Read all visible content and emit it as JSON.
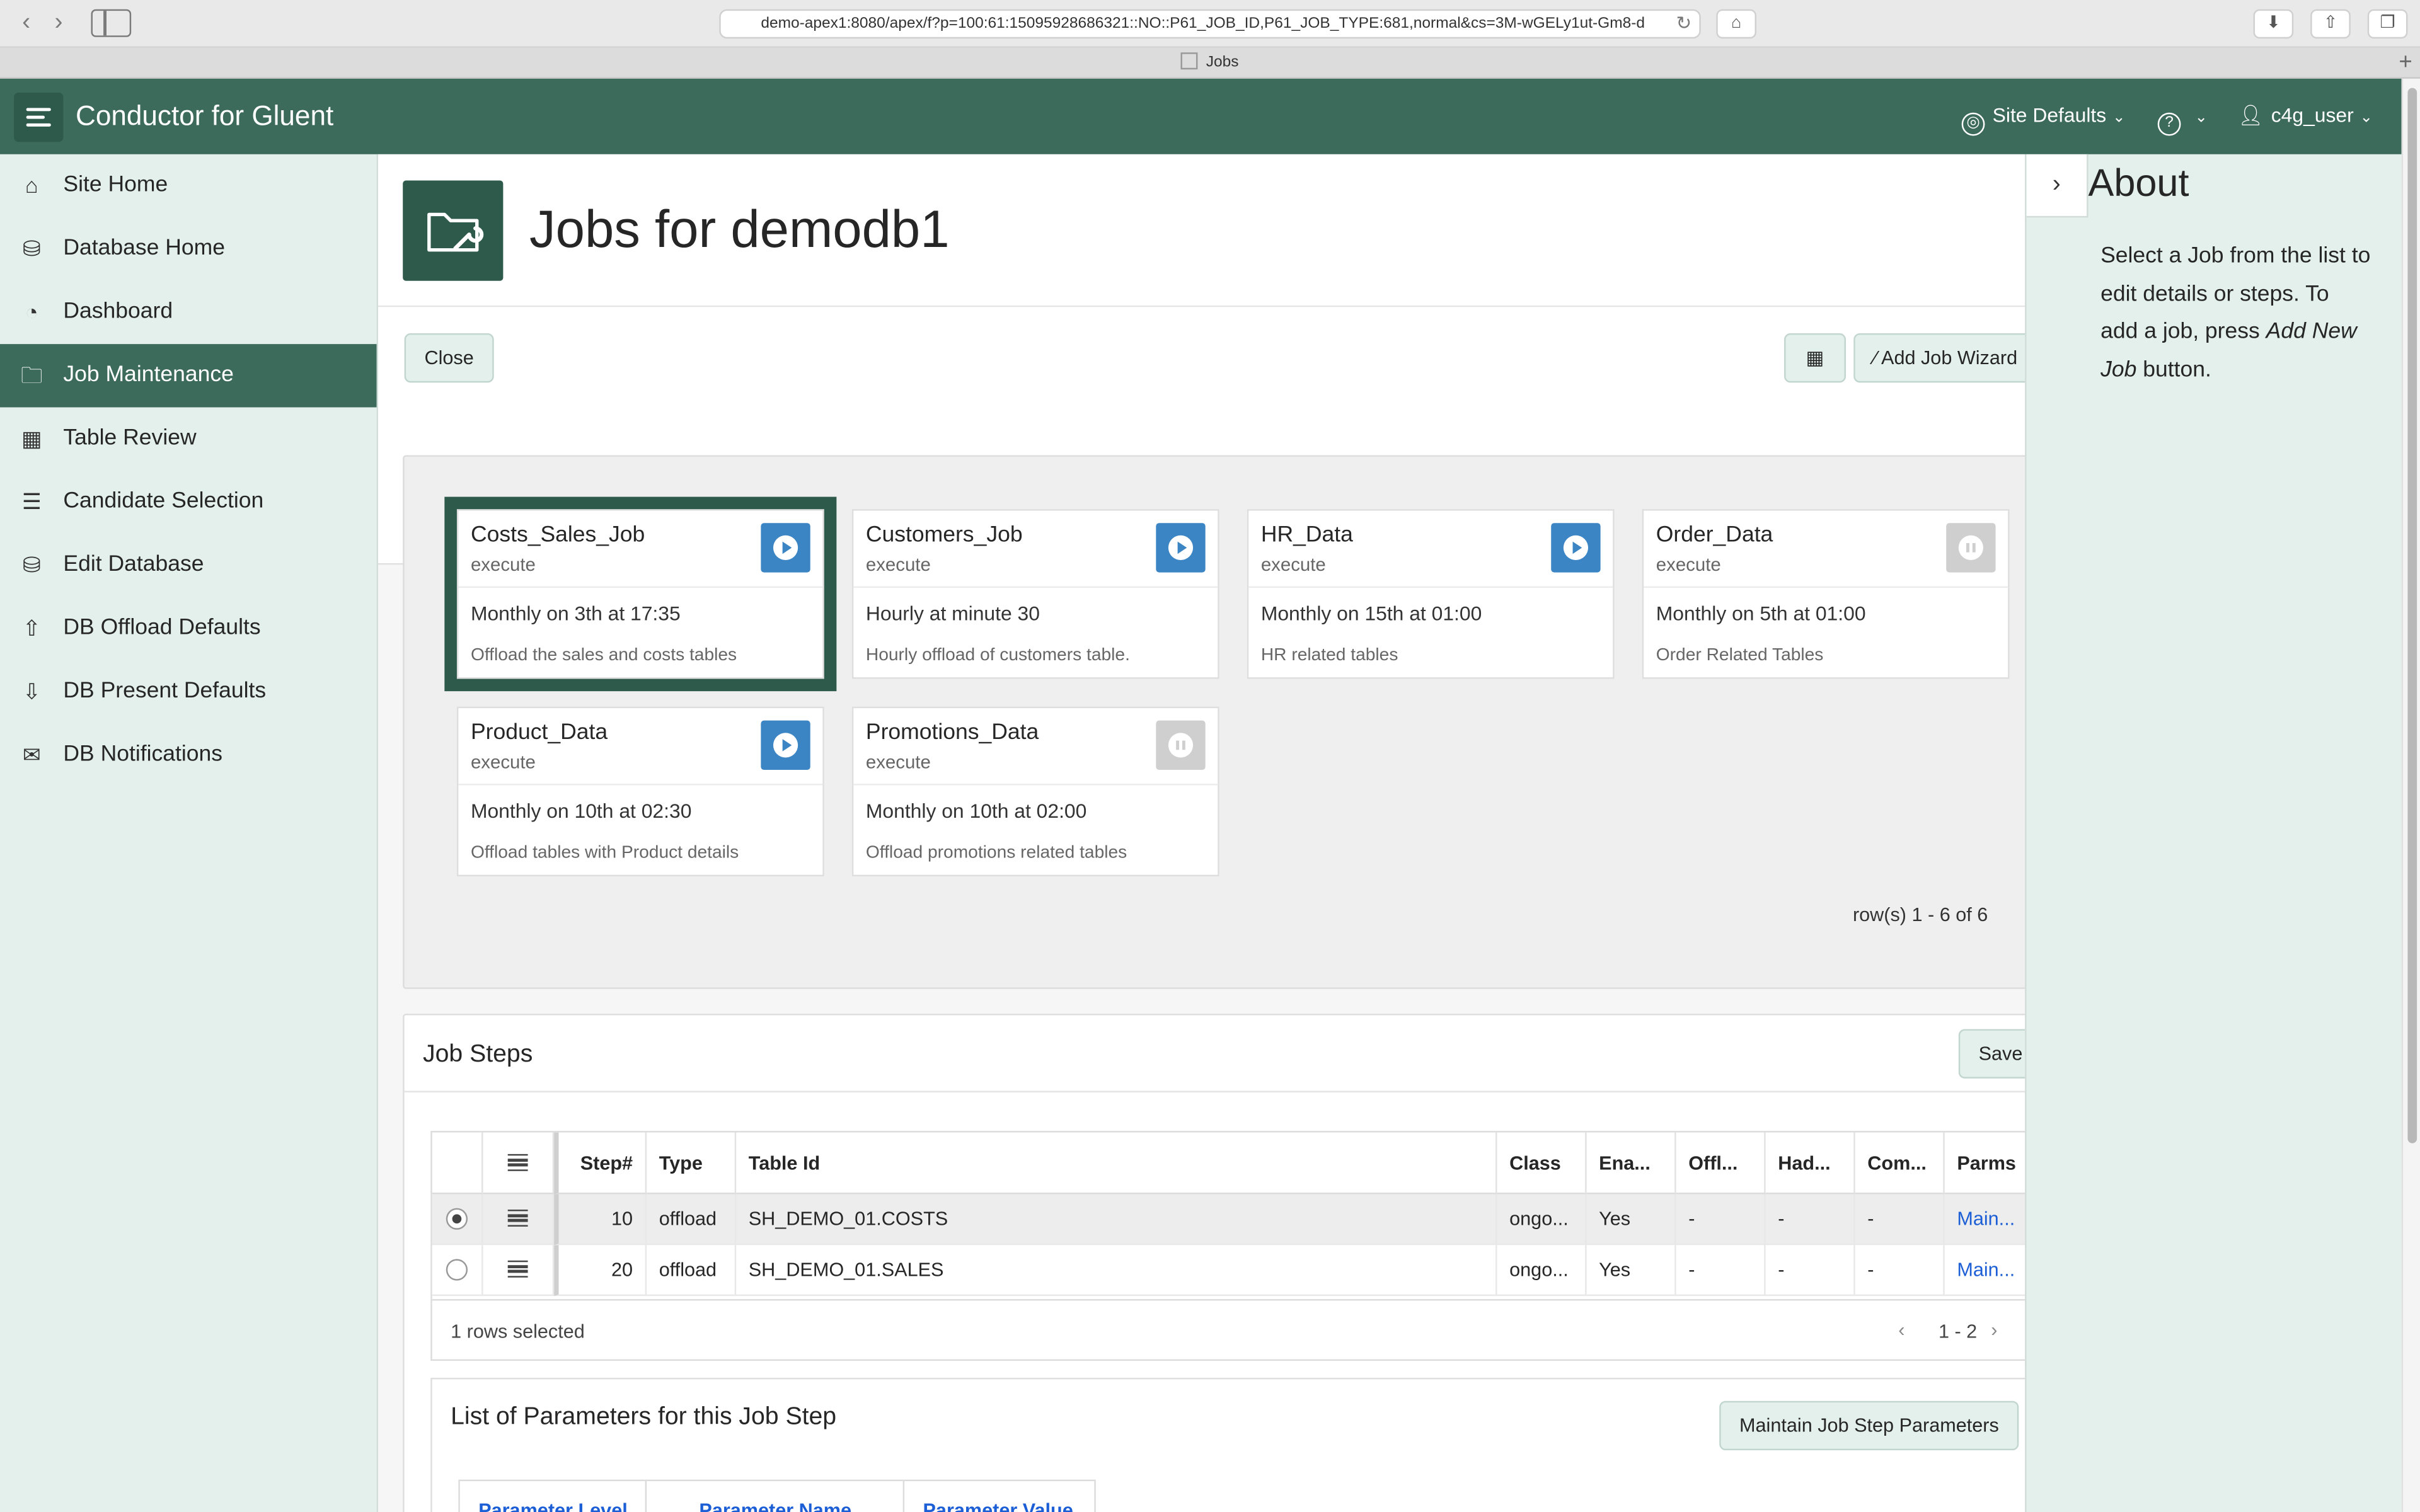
{
  "browser": {
    "url": "demo-apex1:8080/apex/f?p=100:61:15095928686321::NO::P61_JOB_ID,P61_JOB_TYPE:681,normal&cs=3M-wGELy1ut-Gm8-d",
    "tab_title": "Jobs"
  },
  "header": {
    "app_title": "Conductor for Gluent",
    "site_defaults": "Site Defaults",
    "help_icon": "?",
    "user": "c4g_user"
  },
  "nav": {
    "items": [
      {
        "label": "Site Home",
        "icon": "home-icon"
      },
      {
        "label": "Database Home",
        "icon": "database-icon"
      },
      {
        "label": "Dashboard",
        "icon": "dashboard-icon"
      },
      {
        "label": "Job Maintenance",
        "icon": "folder-wrench-icon",
        "active": true
      },
      {
        "label": "Table Review",
        "icon": "table-icon"
      },
      {
        "label": "Candidate Selection",
        "icon": "sliders-icon"
      },
      {
        "label": "Edit Database",
        "icon": "database-edit-icon"
      },
      {
        "label": "DB Offload Defaults",
        "icon": "upload-icon"
      },
      {
        "label": "DB Present Defaults",
        "icon": "download-icon"
      },
      {
        "label": "DB Notifications",
        "icon": "mail-icon"
      }
    ]
  },
  "page": {
    "title": "Jobs for demodb1",
    "close_label": "Close",
    "add_job_wizard_label": "Add Job Wizard"
  },
  "jobs": {
    "cards": [
      {
        "name": "Costs_Sales_Job",
        "sub": "execute",
        "schedule": "Monthly on 3th at 17:35",
        "desc": "Offload the sales and costs tables",
        "enabled": true,
        "selected": true
      },
      {
        "name": "Customers_Job",
        "sub": "execute",
        "schedule": "Hourly at minute 30",
        "desc": "Hourly offload of customers table.",
        "enabled": true
      },
      {
        "name": "HR_Data",
        "sub": "execute",
        "schedule": "Monthly on 15th at 01:00",
        "desc": "HR related tables",
        "enabled": true
      },
      {
        "name": "Order_Data",
        "sub": "execute",
        "schedule": "Monthly on 5th at 01:00",
        "desc": "Order Related Tables",
        "enabled": false
      },
      {
        "name": "Product_Data",
        "sub": "execute",
        "schedule": "Monthly on 10th at 02:30",
        "desc": "Offload tables with Product details",
        "enabled": true
      },
      {
        "name": "Promotions_Data",
        "sub": "execute",
        "schedule": "Monthly on 10th at 02:00",
        "desc": "Offload promotions related tables",
        "enabled": false
      }
    ],
    "row_count": "row(s) 1 - 6 of 6"
  },
  "steps": {
    "title": "Job Steps",
    "save_label": "Save",
    "columns": [
      "Step#",
      "Type",
      "Table Id",
      "Class",
      "Ena...",
      "Offl...",
      "Had...",
      "Com...",
      "Parms"
    ],
    "rows": [
      {
        "step": "10",
        "type": "offload",
        "table_id": "SH_DEMO_01.COSTS",
        "class": "ongo...",
        "enabled": "Yes",
        "offl": "-",
        "had": "-",
        "com": "-",
        "parms": "Main...",
        "selected": true
      },
      {
        "step": "20",
        "type": "offload",
        "table_id": "SH_DEMO_01.SALES",
        "class": "ongo...",
        "enabled": "Yes",
        "offl": "-",
        "had": "-",
        "com": "-",
        "parms": "Main...",
        "selected": false
      }
    ],
    "selected_count": "1 rows selected",
    "pagination": "1 - 2"
  },
  "params": {
    "title": "List of Parameters for this Job Step",
    "maintain_label": "Maintain Job Step Parameters",
    "columns": [
      "Parameter Level",
      "Parameter Name",
      "Parameter Value"
    ]
  },
  "about": {
    "title": "About",
    "text_before": "Select a Job from the list to edit details or steps. To add a job, press ",
    "text_em": "Add New Job",
    "text_after": " button."
  }
}
